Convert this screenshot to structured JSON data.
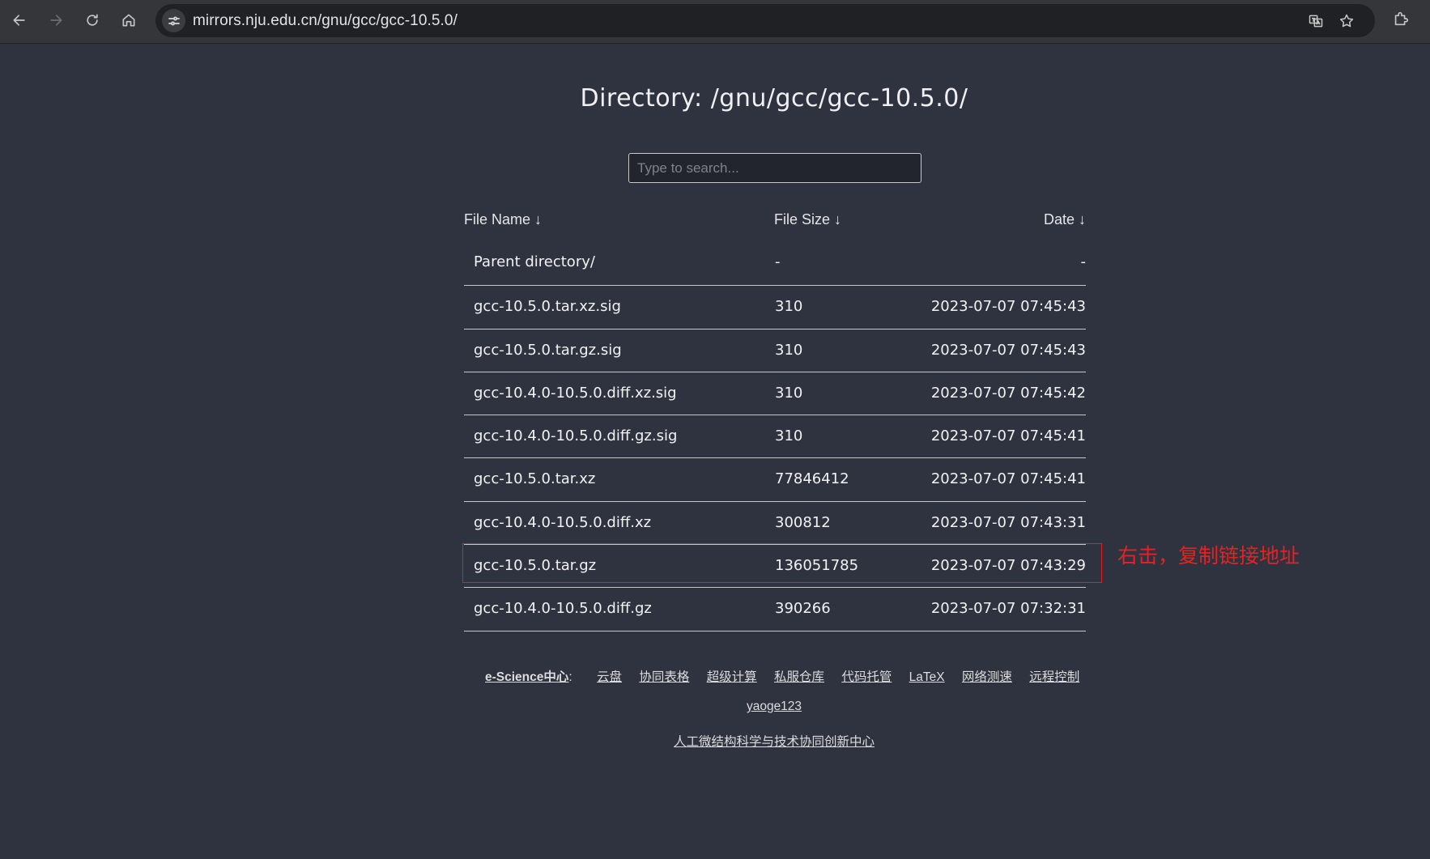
{
  "browser": {
    "url": "mirrors.nju.edu.cn/gnu/gcc/gcc-10.5.0/",
    "icons": [
      "back-icon",
      "forward-icon",
      "reload-icon",
      "home-icon",
      "site-info-icon",
      "translate-icon",
      "star-icon",
      "extensions-icon"
    ]
  },
  "page": {
    "title": "Directory: /gnu/gcc/gcc-10.5.0/",
    "search_placeholder": "Type to search..."
  },
  "table": {
    "headers": {
      "name": "File Name  ↓",
      "size": "File Size  ↓",
      "date": "Date  ↓"
    },
    "rows": [
      {
        "name": "Parent directory/",
        "size": "-",
        "date": "-"
      },
      {
        "name": "gcc-10.5.0.tar.xz.sig",
        "size": "310",
        "date": "2023-07-07 07:45:43"
      },
      {
        "name": "gcc-10.5.0.tar.gz.sig",
        "size": "310",
        "date": "2023-07-07 07:45:43"
      },
      {
        "name": "gcc-10.4.0-10.5.0.diff.xz.sig",
        "size": "310",
        "date": "2023-07-07 07:45:42"
      },
      {
        "name": "gcc-10.4.0-10.5.0.diff.gz.sig",
        "size": "310",
        "date": "2023-07-07 07:45:41"
      },
      {
        "name": "gcc-10.5.0.tar.xz",
        "size": "77846412",
        "date": "2023-07-07 07:45:41"
      },
      {
        "name": "gcc-10.4.0-10.5.0.diff.xz",
        "size": "300812",
        "date": "2023-07-07 07:43:31"
      },
      {
        "name": "gcc-10.5.0.tar.gz",
        "size": "136051785",
        "date": "2023-07-07 07:43:29"
      },
      {
        "name": "gcc-10.4.0-10.5.0.diff.gz",
        "size": "390266",
        "date": "2023-07-07 07:32:31"
      }
    ]
  },
  "annotation": {
    "text": "右击，复制链接地址",
    "color": "#e52222"
  },
  "footer": {
    "lead": "e-Science中心",
    "lead_suffix": ":",
    "links": [
      "云盘",
      "协同表格",
      "超级计算",
      "私服仓库",
      "代码托管",
      "LaTeX",
      "网络测速",
      "远程控制"
    ],
    "user": "yaoge123",
    "org": "人工微结构科学与技术协同创新中心"
  },
  "colors": {
    "background": "#2f3340",
    "text": "#f2f2f2",
    "border": "#c8c8c8"
  }
}
